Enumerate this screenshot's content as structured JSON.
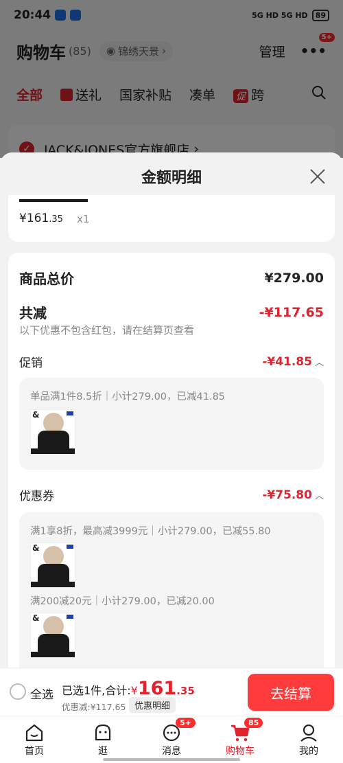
{
  "status_bar": {
    "time": "20:44",
    "battery": "89",
    "network": "5G HD 5G HD"
  },
  "cart": {
    "title": "购物车",
    "count": "(85)",
    "location": "锦绣天景",
    "manage": "管理",
    "more_badge": "5+"
  },
  "category_tabs": [
    "全部",
    "送礼",
    "国家补贴",
    "凑单",
    "跨"
  ],
  "store": {
    "name": "JACK&JONES官方旗舰店"
  },
  "sheet": {
    "title": "金额明细",
    "product": {
      "price_main": "¥161",
      "price_dec": ".35",
      "qty": "x1"
    },
    "total_label": "商品总价",
    "total_value": "¥279.00",
    "reduce_label": "共减",
    "reduce_value": "-¥117.65",
    "reduce_note": "以下优惠不包含红包，请在结算页查看",
    "promo_label": "促销",
    "promo_value": "-¥41.85",
    "promo_detail": "单品满1件8.5折｜小计279.00，已减41.85",
    "coupon_label": "优惠券",
    "coupon_value": "-¥75.80",
    "coupon_detail_1": "满1享8折，最高减3999元｜小计279.00，已减55.80",
    "coupon_detail_2": "满200减20元｜小计279.00，已减20.00"
  },
  "checkout": {
    "select_all": "全选",
    "selected_text": "已选1件,合计:",
    "yen": "¥",
    "total_main": "161",
    "total_dec": ".35",
    "discount_text": "优惠减:¥117.65",
    "detail_button": "优惠明细",
    "pay_button": "去结算"
  },
  "tabbar": {
    "items": [
      {
        "label": "首页"
      },
      {
        "label": "逛"
      },
      {
        "label": "消息",
        "badge": "5+"
      },
      {
        "label": "购物车",
        "badge": "85"
      },
      {
        "label": "我的"
      }
    ]
  },
  "colors": {
    "accent": "#e0232f",
    "pay": "#ff3b3b"
  }
}
